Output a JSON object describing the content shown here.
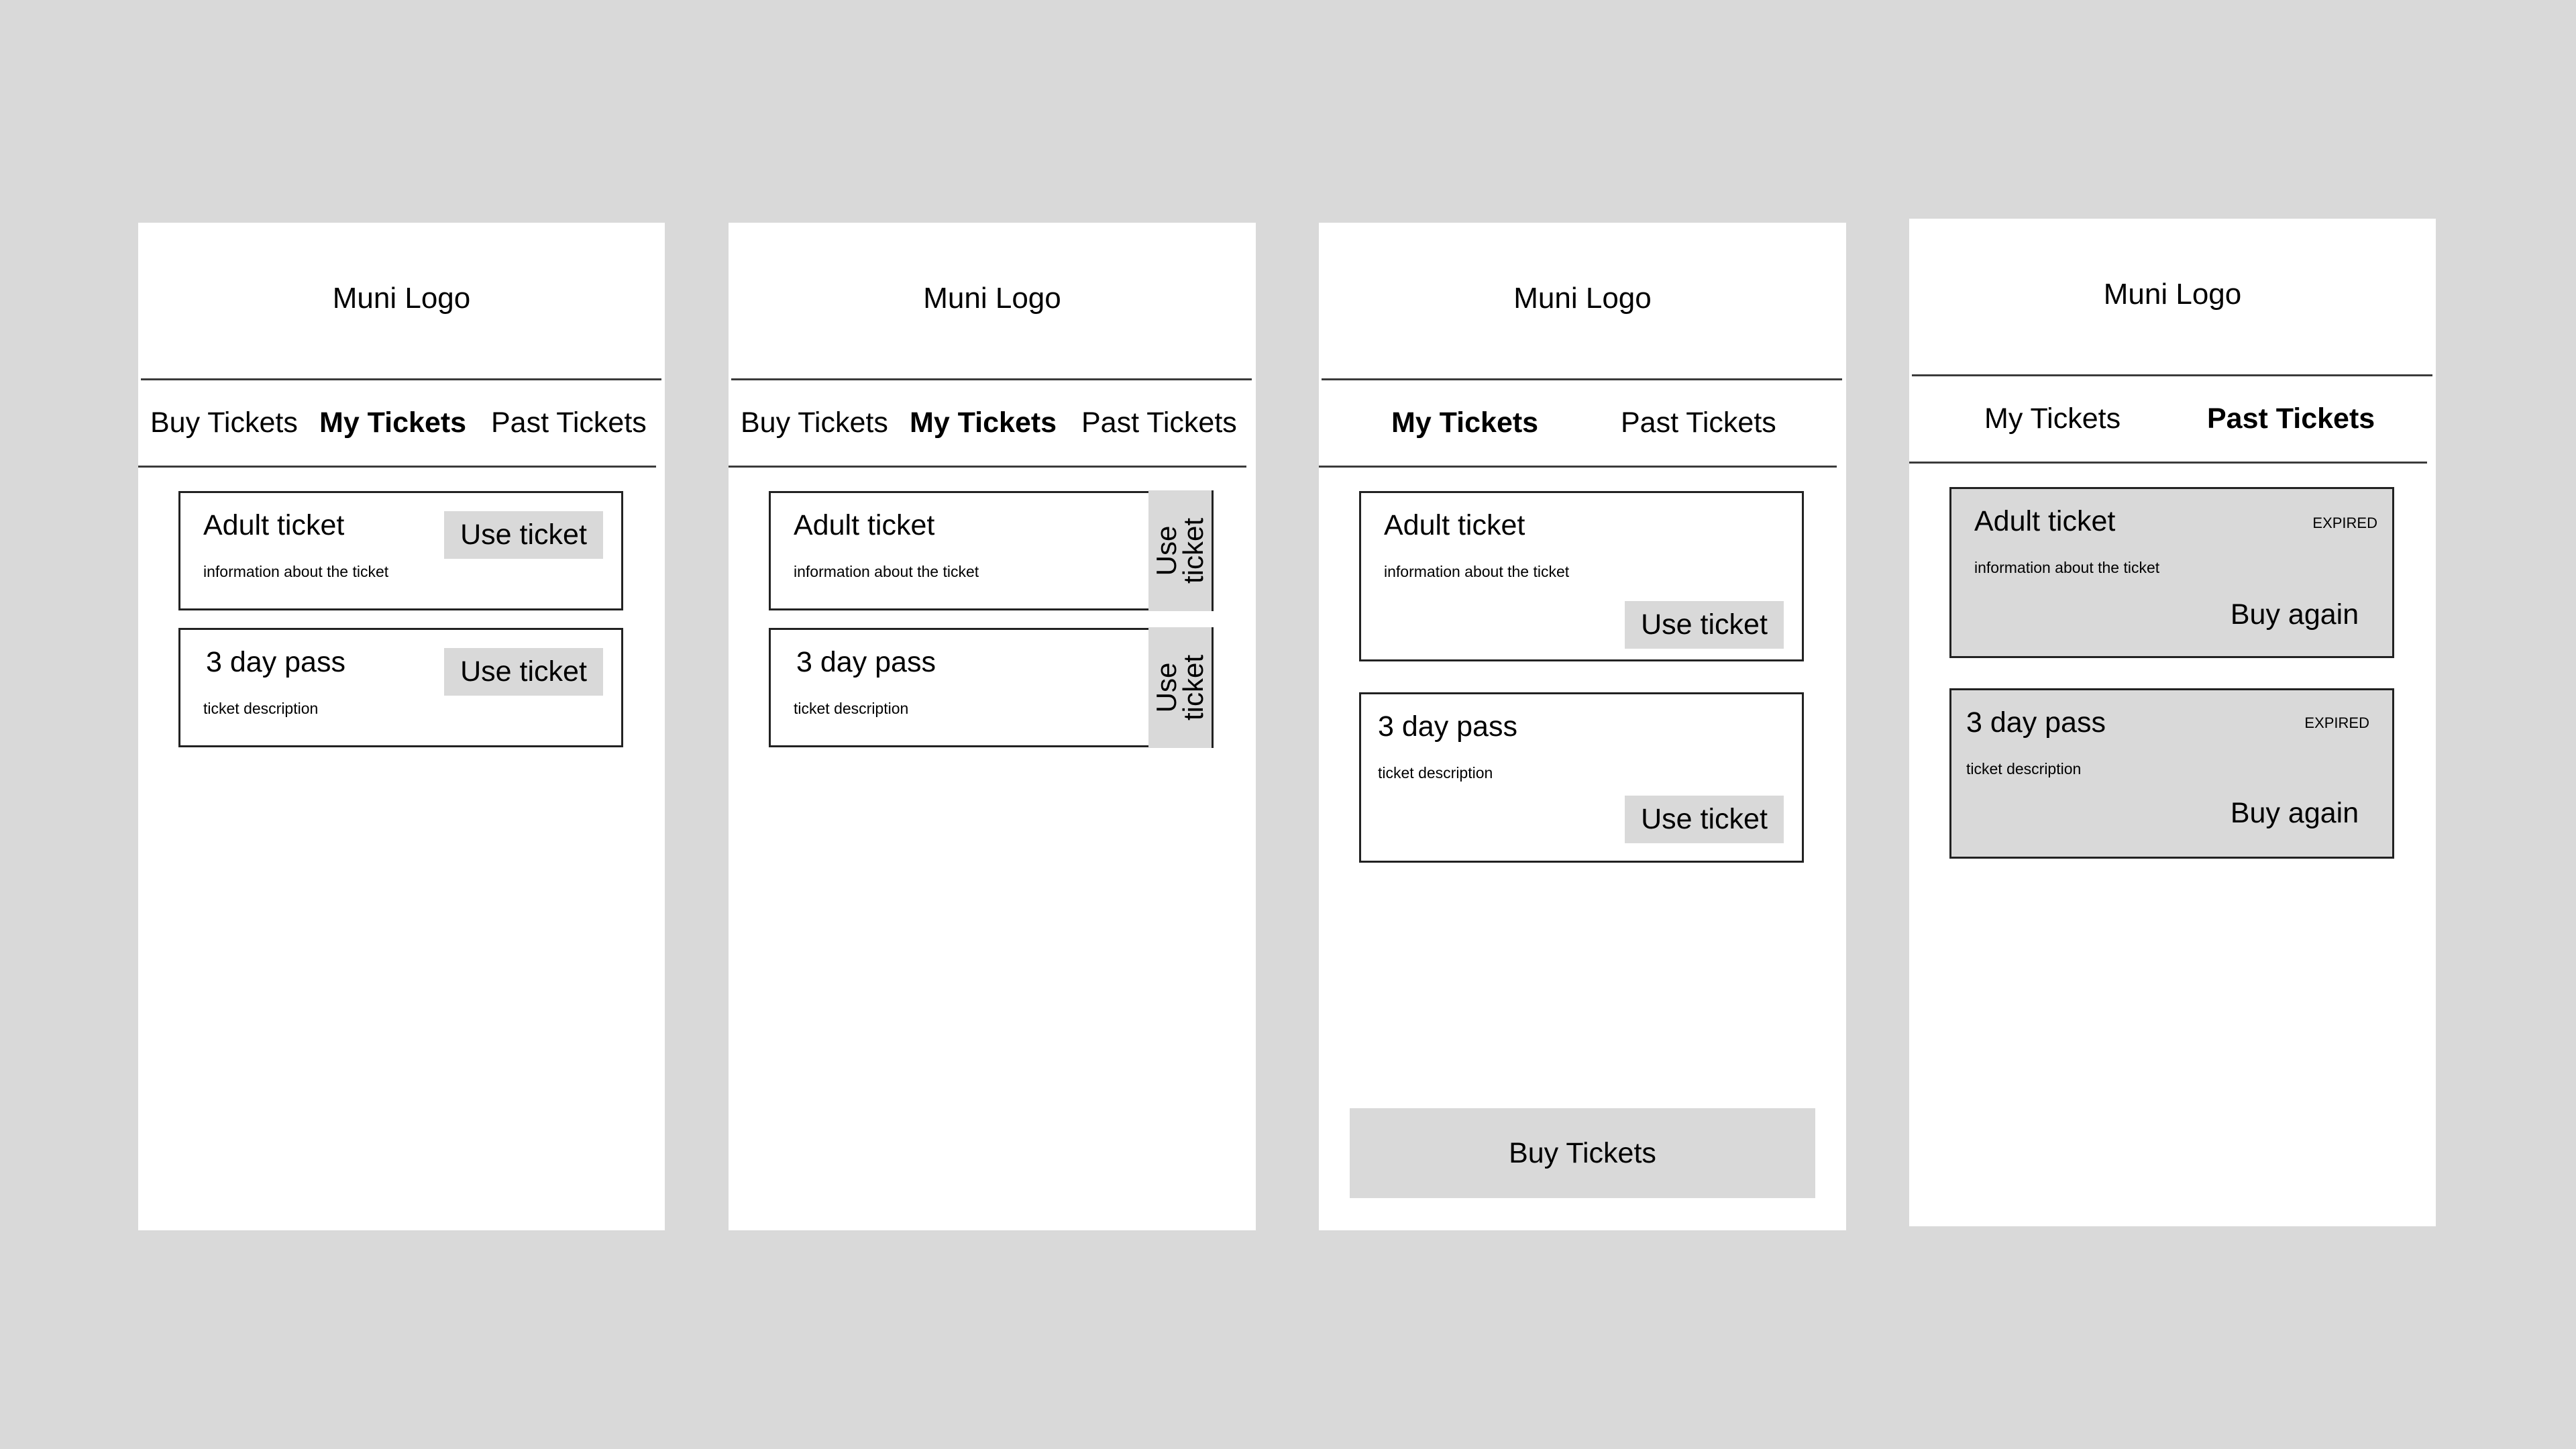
{
  "screens": [
    {
      "logo": "Muni Logo",
      "tabs": [
        "Buy Tickets",
        "My Tickets",
        "Past Tickets"
      ],
      "active_tab": "My Tickets",
      "tickets": [
        {
          "title": "Adult ticket",
          "desc": "information about the ticket",
          "action": "Use ticket"
        },
        {
          "title": "3 day pass",
          "desc": "ticket description",
          "action": "Use ticket"
        }
      ]
    },
    {
      "logo": "Muni Logo",
      "tabs": [
        "Buy Tickets",
        "My Tickets",
        "Past Tickets"
      ],
      "active_tab": "My Tickets",
      "tickets": [
        {
          "title": "Adult ticket",
          "desc": "information about the ticket",
          "action_line1": "Use",
          "action_line2": "ticket"
        },
        {
          "title": "3 day pass",
          "desc": "ticket description",
          "action_line1": "Use",
          "action_line2": "ticket"
        }
      ]
    },
    {
      "logo": "Muni Logo",
      "tabs": [
        "My Tickets",
        "Past Tickets"
      ],
      "active_tab": "My Tickets",
      "tickets": [
        {
          "title": "Adult ticket",
          "desc": "information about the ticket",
          "action": "Use ticket"
        },
        {
          "title": "3 day pass",
          "desc": "ticket description",
          "action": "Use ticket"
        }
      ],
      "bottom_button": "Buy Tickets"
    },
    {
      "logo": "Muni Logo",
      "tabs": [
        "My Tickets",
        "Past Tickets"
      ],
      "active_tab": "Past Tickets",
      "tickets": [
        {
          "title": "Adult ticket",
          "desc": "information about the ticket",
          "status": "EXPIRED",
          "action": "Buy again"
        },
        {
          "title": "3 day pass",
          "desc": "ticket description",
          "status": "EXPIRED",
          "action": "Buy again"
        }
      ]
    }
  ],
  "colors": {
    "background": "#d9d9d9",
    "screen": "#ffffff",
    "button": "#d9d9d9",
    "border": "#222222"
  }
}
